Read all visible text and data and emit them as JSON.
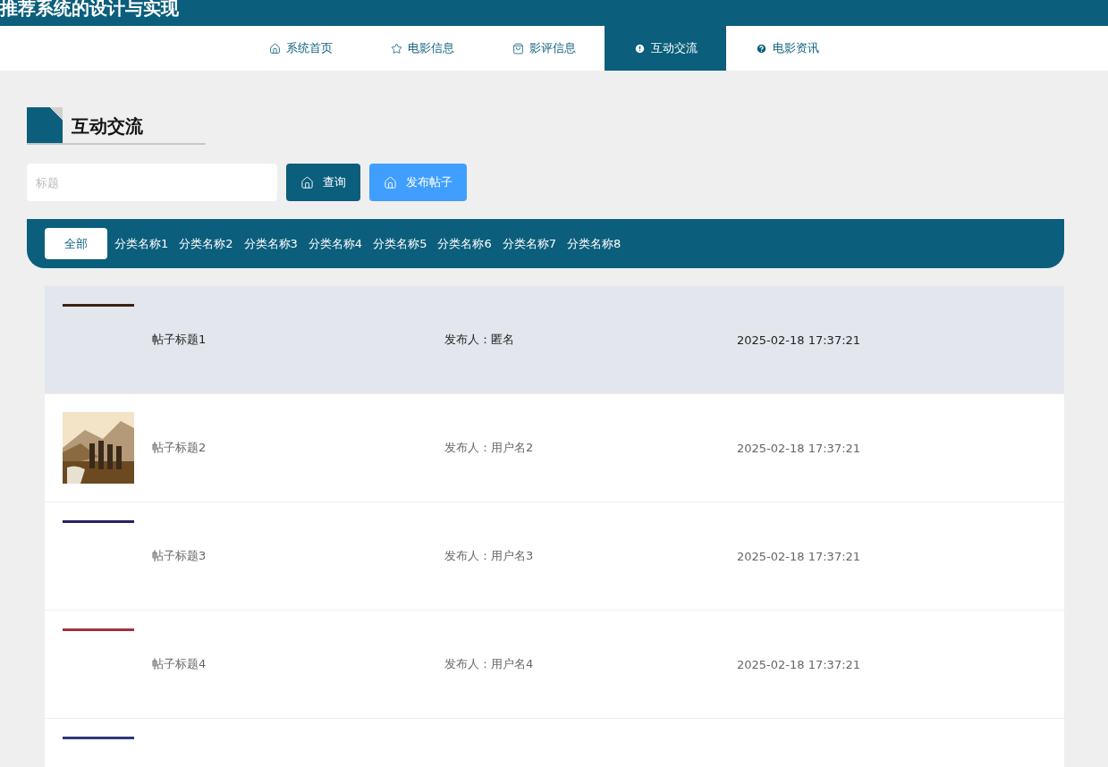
{
  "header": {
    "title": "推荐系统的设计与实现"
  },
  "nav": [
    {
      "label": "系统首页",
      "selected": false
    },
    {
      "label": "电影信息",
      "selected": false
    },
    {
      "label": "影评信息",
      "selected": false
    },
    {
      "label": "互动交流",
      "selected": true
    },
    {
      "label": "电影资讯",
      "selected": false
    }
  ],
  "section_title": "互动交流",
  "search": {
    "placeholder": "标题",
    "query_button": "查询",
    "publish_button": "发布帖子"
  },
  "categories": [
    {
      "label": "全部",
      "selected": true
    },
    {
      "label": "分类名称1",
      "selected": false
    },
    {
      "label": "分类名称2",
      "selected": false
    },
    {
      "label": "分类名称3",
      "selected": false
    },
    {
      "label": "分类名称4",
      "selected": false
    },
    {
      "label": "分类名称5",
      "selected": false
    },
    {
      "label": "分类名称6",
      "selected": false
    },
    {
      "label": "分类名称7",
      "selected": false
    },
    {
      "label": "分类名称8",
      "selected": false
    }
  ],
  "posts": [
    {
      "kind": "strip",
      "color": "#3a2410",
      "highlighted": true,
      "title": "帖子标题1",
      "author": "发布人：匿名",
      "time": "2025-02-18 17:37:21"
    },
    {
      "kind": "picture",
      "highlighted": false,
      "title": "帖子标题2",
      "author": "发布人：用户名2",
      "time": "2025-02-18 17:37:21"
    },
    {
      "kind": "strip",
      "color": "#2a2060",
      "highlighted": false,
      "title": "帖子标题3",
      "author": "发布人：用户名3",
      "time": "2025-02-18 17:37:21"
    },
    {
      "kind": "strip",
      "color": "#a03040",
      "highlighted": false,
      "title": "帖子标题4",
      "author": "发布人：用户名4",
      "time": "2025-02-18 17:37:21"
    },
    {
      "kind": "strip",
      "color": "#303878",
      "highlighted": false
    }
  ]
}
